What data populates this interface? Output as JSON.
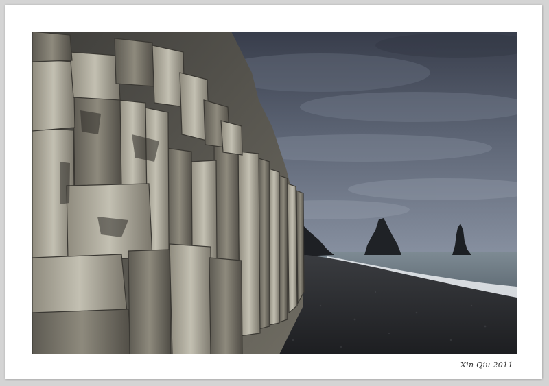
{
  "photo": {
    "subject": "basalt-columns-black-sand-beach",
    "sea_stack_count": 2
  },
  "signature": {
    "text": "Xin Qiu 2011"
  },
  "colors": {
    "frame_outer": "#d4d4d4",
    "mat": "#ffffff",
    "sky_top": "#3b4150",
    "sky_bottom": "#7a8494",
    "sea": "#6f7c86",
    "surf": "#dfe3e6",
    "sand": "#26282c",
    "basalt_light": "#b9b6a8",
    "basalt_dark": "#4d4a44"
  }
}
